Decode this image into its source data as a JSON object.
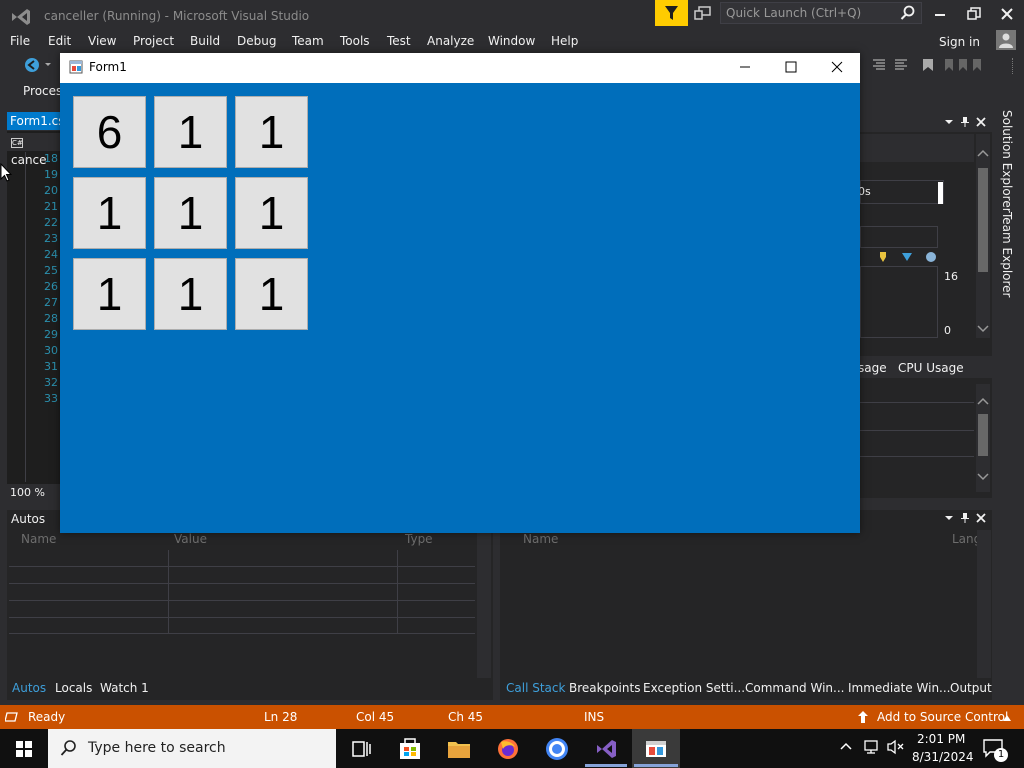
{
  "vs": {
    "title": "canceller (Running) - Microsoft Visual Studio",
    "quick_launch_placeholder": "Quick Launch (Ctrl+Q)",
    "menu": [
      "File",
      "Edit",
      "View",
      "Project",
      "Build",
      "Debug",
      "Team",
      "Tools",
      "Test",
      "Analyze",
      "Window",
      "Help"
    ],
    "sign_in": "Sign in",
    "process_label": "Proces",
    "document_tab": "Form1.cs",
    "nav_dropdown": "cance",
    "line_numbers": [
      "18",
      "19",
      "20",
      "21",
      "22",
      "23",
      "24",
      "25",
      "26",
      "27",
      "28",
      "29",
      "30",
      "31",
      "32",
      "33"
    ],
    "zoom": "100 %",
    "diag": {
      "timeline_label": "0s",
      "value_high": "16",
      "value_low": "0",
      "tab_memory": "sage",
      "tab_cpu": "CPU Usage"
    },
    "side_tabs": [
      "Solution Explorer",
      "Team Explorer"
    ],
    "autos": {
      "title": "Autos",
      "columns": [
        "Name",
        "Value",
        "Type"
      ]
    },
    "callstack": {
      "columns": [
        "Name",
        "Lang"
      ]
    },
    "bottom_tabs_left": [
      "Autos",
      "Locals",
      "Watch 1"
    ],
    "bottom_tabs_right": [
      "Call Stack",
      "Breakpoints",
      "Exception Setti...",
      "Command Win...",
      "Immediate Win...",
      "Output"
    ]
  },
  "status": {
    "ready": "Ready",
    "line": "Ln 28",
    "col": "Col 45",
    "ch": "Ch 45",
    "mode": "INS",
    "source_control": "Add to Source Control",
    "bar_color": "#ca5100"
  },
  "form": {
    "title": "Form1",
    "client_color": "#006ebb",
    "grid": [
      "6",
      "1",
      "1",
      "1",
      "1",
      "1",
      "1",
      "1",
      "1"
    ]
  },
  "taskbar": {
    "search_placeholder": "Type here to search",
    "time": "2:01 PM",
    "date": "8/31/2024",
    "notification_count": "1"
  }
}
